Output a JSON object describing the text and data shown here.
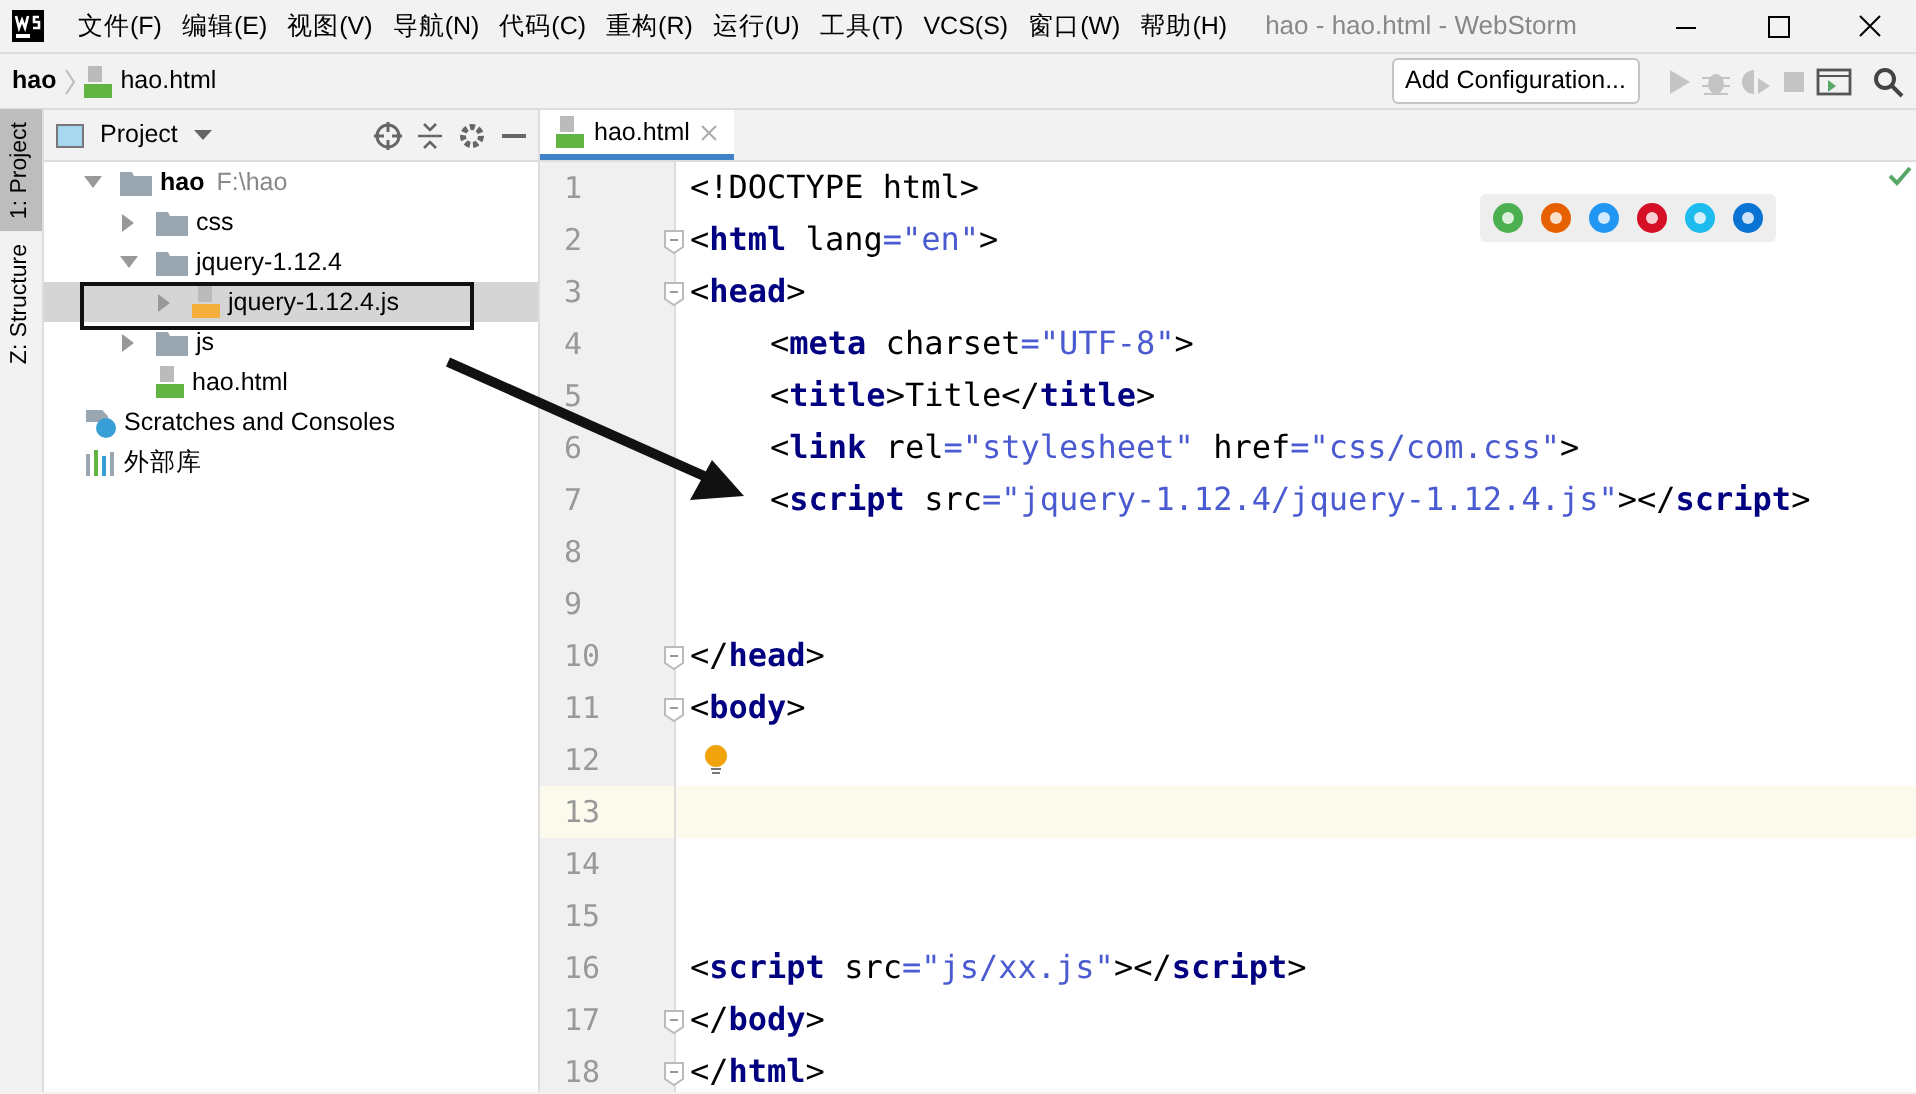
{
  "window": {
    "title": "hao - hao.html - WebStorm"
  },
  "menu": [
    "文件(F)",
    "编辑(E)",
    "视图(V)",
    "导航(N)",
    "代码(C)",
    "重构(R)",
    "运行(U)",
    "工具(T)",
    "VCS(S)",
    "窗口(W)",
    "帮助(H)"
  ],
  "breadcrumbs": [
    {
      "label": "hao",
      "kind": "folder"
    },
    {
      "label": "hao.html",
      "kind": "html"
    }
  ],
  "toolbar": {
    "config_button": "Add Configuration...",
    "run_disabled": true
  },
  "side_tabs": [
    {
      "label": "1: Project",
      "selected": true
    },
    {
      "label": "Z: Structure",
      "selected": false
    }
  ],
  "project_panel": {
    "title": "Project",
    "tree": [
      {
        "label": "hao",
        "path": "F:\\hao",
        "kind": "folder",
        "expanded": true,
        "selected": false,
        "children": [
          {
            "label": "css",
            "kind": "folder",
            "expanded": false,
            "selected": false
          },
          {
            "label": "jquery-1.12.4",
            "kind": "folder",
            "expanded": true,
            "selected": false,
            "children": [
              {
                "label": "jquery-1.12.4.js",
                "kind": "js",
                "expanded": false,
                "selected": true
              }
            ]
          },
          {
            "label": "js",
            "kind": "folder",
            "expanded": false,
            "selected": false
          },
          {
            "label": "hao.html",
            "kind": "html",
            "selected": false
          }
        ]
      },
      {
        "label": "Scratches and Consoles",
        "kind": "scratch",
        "selected": false
      },
      {
        "label": "外部库",
        "kind": "library",
        "selected": false
      }
    ]
  },
  "editor_tabs": [
    {
      "label": "hao.html",
      "selected": true
    }
  ],
  "code_lines": [
    {
      "number": "1",
      "current": false,
      "indent": false,
      "tokens": [
        {
          "kind": "plain",
          "text": "<!DOCTYPE html>"
        }
      ]
    },
    {
      "number": "2",
      "current": false,
      "fold": true,
      "indent": false,
      "tokens": [
        {
          "kind": "plain",
          "text": "<"
        },
        {
          "kind": "tag",
          "text": "html"
        },
        {
          "kind": "plain",
          "text": " lang"
        },
        {
          "kind": "value",
          "text": "=\"en\""
        },
        {
          "kind": "plain",
          "text": ">"
        }
      ]
    },
    {
      "number": "3",
      "current": false,
      "fold": true,
      "indent": false,
      "tokens": [
        {
          "kind": "plain",
          "text": "<"
        },
        {
          "kind": "tag",
          "text": "head"
        },
        {
          "kind": "plain",
          "text": ">"
        }
      ]
    },
    {
      "number": "4",
      "current": false,
      "indent": true,
      "tokens": [
        {
          "kind": "plain",
          "text": "<"
        },
        {
          "kind": "tag",
          "text": "meta"
        },
        {
          "kind": "plain",
          "text": " charset"
        },
        {
          "kind": "value",
          "text": "=\"UTF-8\""
        },
        {
          "kind": "plain",
          "text": ">"
        }
      ]
    },
    {
      "number": "5",
      "current": false,
      "indent": true,
      "tokens": [
        {
          "kind": "plain",
          "text": "<"
        },
        {
          "kind": "tag",
          "text": "title"
        },
        {
          "kind": "plain",
          "text": ">Title</"
        },
        {
          "kind": "tag",
          "text": "title"
        },
        {
          "kind": "plain",
          "text": ">"
        }
      ]
    },
    {
      "number": "6",
      "current": false,
      "indent": true,
      "tokens": [
        {
          "kind": "plain",
          "text": "<"
        },
        {
          "kind": "tag",
          "text": "link"
        },
        {
          "kind": "plain",
          "text": " rel"
        },
        {
          "kind": "value",
          "text": "=\"stylesheet\""
        },
        {
          "kind": "plain",
          "text": " href"
        },
        {
          "kind": "value",
          "text": "=\"css/com.css\""
        },
        {
          "kind": "plain",
          "text": ">"
        }
      ]
    },
    {
      "number": "7",
      "current": false,
      "indent": true,
      "tokens": [
        {
          "kind": "plain",
          "text": "<"
        },
        {
          "kind": "tag",
          "text": "script"
        },
        {
          "kind": "plain",
          "text": " src"
        },
        {
          "kind": "value",
          "text": "=\"jquery-1.12.4/jquery-1.12.4.js\""
        },
        {
          "kind": "plain",
          "text": "></"
        },
        {
          "kind": "tag",
          "text": "script"
        },
        {
          "kind": "plain",
          "text": ">"
        }
      ]
    },
    {
      "number": "8",
      "current": false
    },
    {
      "number": "9",
      "current": false
    },
    {
      "number": "10",
      "current": false,
      "fold": true,
      "indent": false,
      "tokens": [
        {
          "kind": "plain",
          "text": "</"
        },
        {
          "kind": "tag",
          "text": "head"
        },
        {
          "kind": "plain",
          "text": ">"
        }
      ]
    },
    {
      "number": "11",
      "current": false,
      "fold": true,
      "indent": false,
      "tokens": [
        {
          "kind": "plain",
          "text": "<"
        },
        {
          "kind": "tag",
          "text": "body"
        },
        {
          "kind": "plain",
          "text": ">"
        }
      ]
    },
    {
      "number": "12",
      "current": false,
      "hint": true
    },
    {
      "number": "13",
      "current": true
    },
    {
      "number": "14",
      "current": false
    },
    {
      "number": "15",
      "current": false
    },
    {
      "number": "16",
      "current": false,
      "indent": false,
      "tokens": [
        {
          "kind": "plain",
          "text": "<"
        },
        {
          "kind": "tag",
          "text": "script"
        },
        {
          "kind": "plain",
          "text": " src"
        },
        {
          "kind": "value",
          "text": "=\"js/xx.js\""
        },
        {
          "kind": "plain",
          "text": "></"
        },
        {
          "kind": "tag",
          "text": "script"
        },
        {
          "kind": "plain",
          "text": ">"
        }
      ]
    },
    {
      "number": "17",
      "current": false,
      "fold": true,
      "indent": false,
      "tokens": [
        {
          "kind": "plain",
          "text": "</"
        },
        {
          "kind": "tag",
          "text": "body"
        },
        {
          "kind": "plain",
          "text": ">"
        }
      ]
    },
    {
      "number": "18",
      "current": false,
      "fold": true,
      "indent": false,
      "tokens": [
        {
          "kind": "plain",
          "text": "</"
        },
        {
          "kind": "tag",
          "text": "html"
        },
        {
          "kind": "plain",
          "text": ">"
        }
      ]
    }
  ],
  "browser_icons": [
    {
      "color": "#4caf50"
    },
    {
      "color": "#e66000"
    },
    {
      "color": "#2196f3"
    },
    {
      "color": "#d50f25"
    },
    {
      "color": "#1ebbee"
    },
    {
      "color": "#0a74d4"
    }
  ]
}
